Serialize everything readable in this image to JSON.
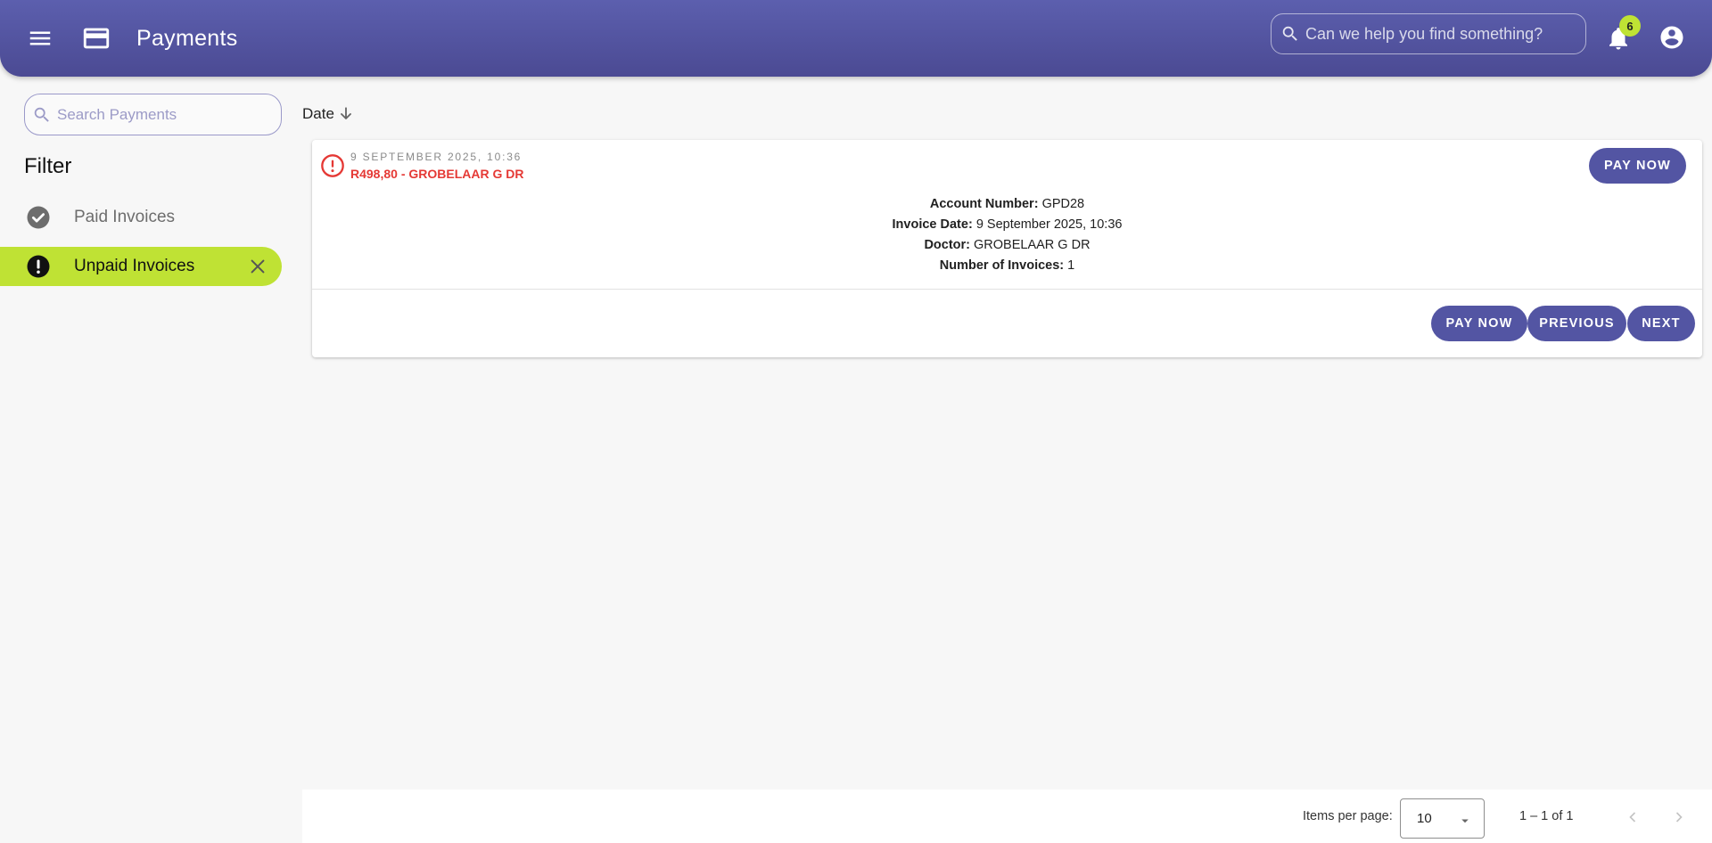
{
  "header": {
    "title": "Payments",
    "search_placeholder": "Can we help you find something?",
    "notification_count": "6",
    "icons": [
      "menu-icon",
      "credit-card-icon",
      "search-icon",
      "bell-icon",
      "account-circle-icon"
    ]
  },
  "sidebar": {
    "search_placeholder": "Search Payments",
    "filter_title": "Filter",
    "items": [
      {
        "label": "Paid Invoices",
        "icon": "check-circle-icon",
        "active": false
      },
      {
        "label": "Unpaid Invoices",
        "icon": "error-circle-icon",
        "active": true
      }
    ]
  },
  "sort": {
    "label": "Date",
    "direction": "descending"
  },
  "invoice": {
    "date": "9 SEPTEMBER 2025, 10:36",
    "amount_line": "R498,80 - GROBELAAR G DR",
    "pay_label": "PAY NOW",
    "details": [
      {
        "label": "Account Number:",
        "value": "GPD28"
      },
      {
        "label": "Invoice Date:",
        "value": "9 September 2025, 10:36"
      },
      {
        "label": "Doctor:",
        "value": "GROBELAAR G DR"
      },
      {
        "label": "Number of Invoices:",
        "value": "1"
      }
    ],
    "footer_buttons": {
      "pay": "PAY NOW",
      "previous": "PREVIOUS",
      "next": "NEXT"
    }
  },
  "paginator": {
    "items_per_page_label": "Items per page:",
    "items_per_page_value": "10",
    "range_label": "1 – 1 of 1"
  },
  "colors": {
    "header": "#5355a3",
    "accent_green": "#bfe234",
    "error_red": "#e53935",
    "button": "#5355a3"
  }
}
